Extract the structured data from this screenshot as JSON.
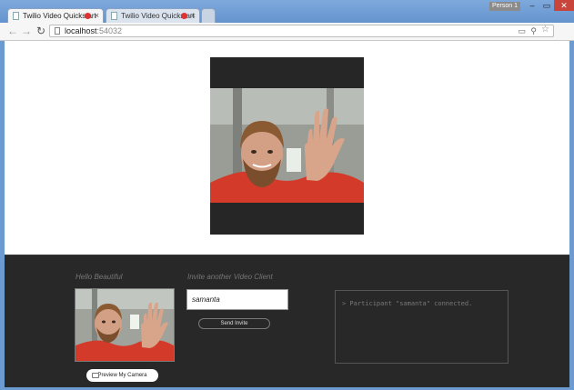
{
  "browser": {
    "tabs": [
      {
        "title": "Twilio Video Quickstart"
      },
      {
        "title": "Twilio Video Quickstart"
      }
    ],
    "profile_label": "Person 1",
    "window_buttons": {
      "minimize": "–",
      "maximize": "▭",
      "close": "✕"
    },
    "nav": {
      "back": "←",
      "forward": "→",
      "reload": "↻",
      "menu": "≡"
    },
    "address": {
      "host": "localhost",
      "port": ":54032"
    }
  },
  "page": {
    "hello_label": "Hello Beautiful",
    "invite_label": "Invite another Video Client",
    "invite_value": "samanta",
    "send_invite_label": "Send Invite",
    "preview_camera_label": "Preview My Camera",
    "log_lines": [
      "> Participant \"samanta\" connected."
    ]
  },
  "colors": {
    "panel": "#282828",
    "accent_record": "#dd3333"
  }
}
